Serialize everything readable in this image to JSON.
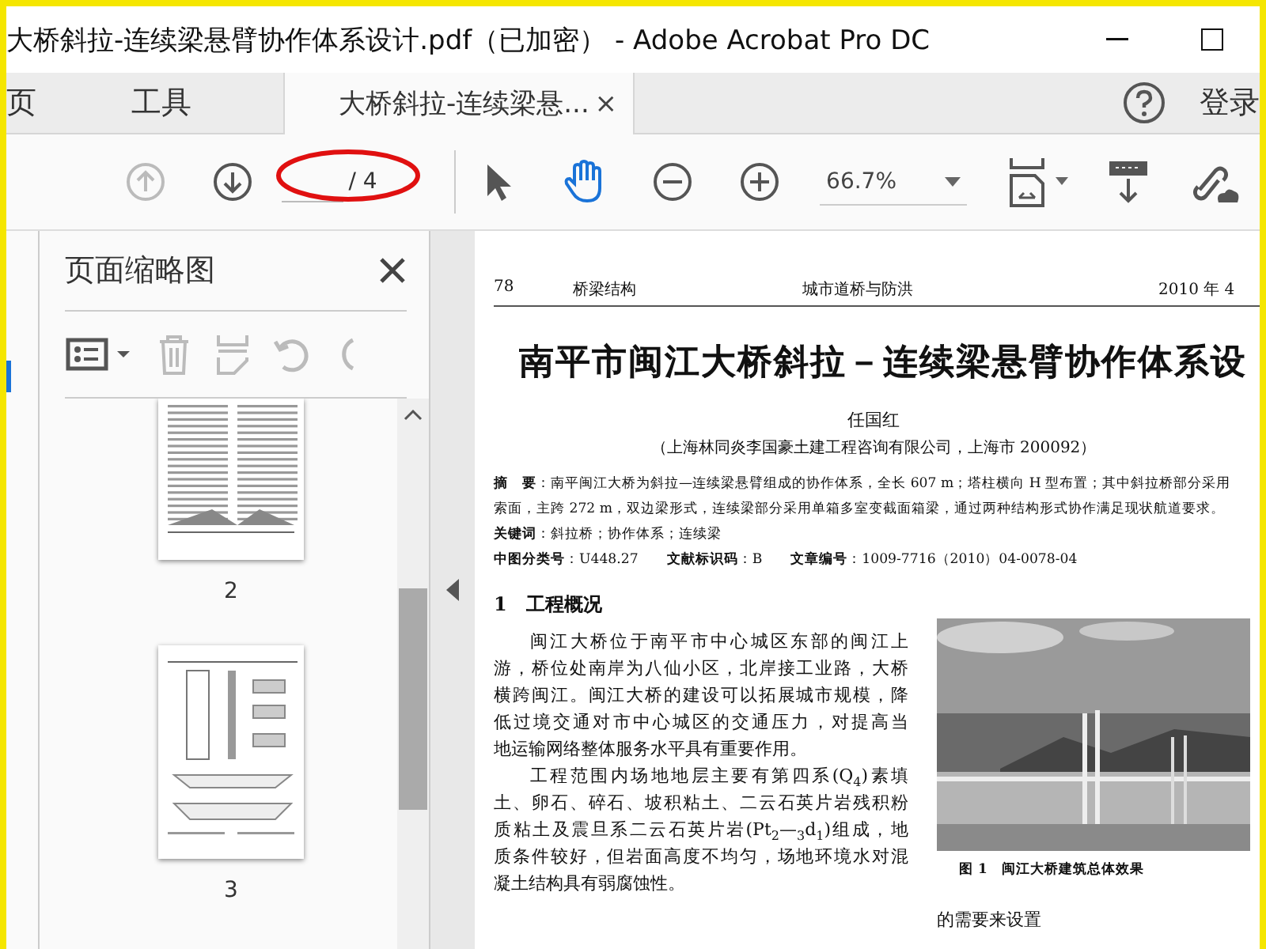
{
  "window": {
    "title": "大桥斜拉-连续梁悬臂协作体系设计.pdf（已加密） - Adobe Acrobat Pro DC"
  },
  "tabs": [
    {
      "label": "页",
      "kind": "nav",
      "selected": false
    },
    {
      "label": "工具",
      "kind": "nav",
      "selected": false
    },
    {
      "label": "大桥斜拉-连续梁悬...",
      "kind": "doc",
      "selected": true,
      "close": "×"
    }
  ],
  "signin": "登录",
  "toolbar": {
    "page_total": "/ 4",
    "zoom": "66.7%",
    "hand_selected": true,
    "prev_disabled": true
  },
  "thumbnails": {
    "title": "页面缩略图",
    "pages": [
      {
        "label": "2",
        "kind": "text"
      },
      {
        "label": "3",
        "kind": "drawing"
      }
    ]
  },
  "document": {
    "header": [
      "78",
      "桥梁结构",
      "城市道桥与防洪",
      "2010 年 4"
    ],
    "title": "南平市闽江大桥斜拉－连续梁悬臂协作体系设",
    "author": "任国红",
    "affiliation": "（上海林同炎李国豪土建工程咨询有限公司，上海市 200092）",
    "abstract": [
      "**摘　要**：南平闽江大桥为斜拉—连续梁悬臂组成的协作体系，全长 607 m；塔柱横向 H 型布置；其中斜拉桥部分采用",
      "索面，主跨 272 m，双边梁形式，连续梁部分采用单箱多室变截面箱梁，通过两种结构形式协作满足现状航道要求。",
      "**关键词**：斜拉桥；协作体系；连续梁",
      "**中图分类号**：U448.27　　**文献标识码**：B　　**文章编号**：1009-7716（2010）04-0078-04"
    ],
    "section": "1　工程概况",
    "body": [
      {
        "kind": "first",
        "text": "闽江大桥位于南平市中心城区东部的闽江上"
      },
      {
        "kind": "line",
        "text": "游，桥位处南岸为八仙小区，北岸接工业路，大桥"
      },
      {
        "kind": "line",
        "text": "横跨闽江。闽江大桥的建设可以拓展城市规模，降"
      },
      {
        "kind": "line",
        "text": "低过境交通对市中心城区的交通压力，对提高当"
      },
      {
        "kind": "last",
        "text": "地运输网络整体服务水平具有重要作用。"
      },
      {
        "kind": "first",
        "text": "工程范围内场地地层主要有第四系(Q$_{4}$)素填"
      },
      {
        "kind": "line",
        "text": "土、卵石、碎石、坡积粘土、二云石英片岩残积粉"
      },
      {
        "kind": "line",
        "text": "质粘土及震旦系二云石英片岩(Pt$_{2}$—$_{3}$d$_{1}$)组成，地"
      },
      {
        "kind": "line",
        "text": "质条件较好，但岩面高度不均匀，场地环境水对混"
      },
      {
        "kind": "last",
        "text": "凝土结构具有弱腐蚀性。"
      }
    ],
    "figure_caption": "图 1　闽江大桥建筑总体效果",
    "right_text": "的需要来设置"
  }
}
